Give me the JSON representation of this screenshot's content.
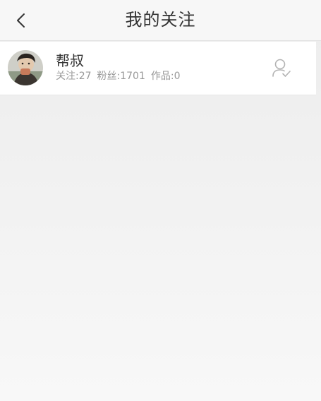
{
  "header": {
    "title": "我的关注",
    "back_icon": "chevron-left-icon"
  },
  "following": [
    {
      "name": "帮叔",
      "following_label": "关注:27",
      "followers_label": "粉丝:1701",
      "works_label": "作品:0",
      "avatar_icon": "avatar",
      "action_icon": "followed-user-icon"
    }
  ],
  "colors": {
    "navbar_bg": "#f7f7f7",
    "page_bg": "#efefef",
    "row_bg": "#ffffff",
    "title_text": "#333333",
    "meta_text": "#999999",
    "icon_gray": "#b3b3b3"
  }
}
